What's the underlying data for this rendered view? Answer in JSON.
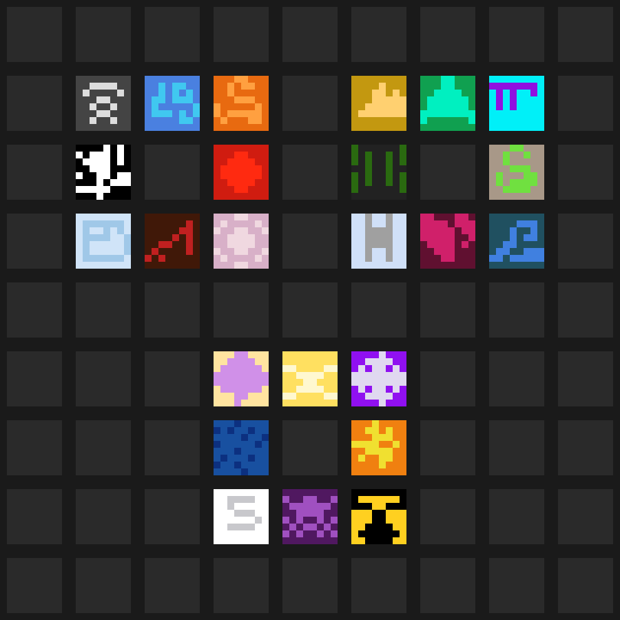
{
  "board": {
    "rows": 9,
    "cols": 9,
    "background": "#1a1a1a",
    "empty_cell_color": "#2a2a2a"
  },
  "tiles": [
    {
      "name": "signal-tile",
      "row": 1,
      "col": 1,
      "bg": "#444444",
      "fg": "#dddddd",
      "pattern": [
        "........",
        "..####..",
        ".#....#.",
        "...##...",
        "..#..#..",
        "...##...",
        "..#..#..",
        "........"
      ]
    },
    {
      "name": "water-tile",
      "row": 1,
      "col": 2,
      "bg": "#4a80e0",
      "fg": "#40c8f0",
      "pattern": [
        "........",
        "..#.##..",
        "..#.#.#.",
        ".##.###.",
        ".#.....#",
        ".###.#.#",
        ".....##.",
        "........"
      ]
    },
    {
      "name": "flame-tile",
      "row": 1,
      "col": 3,
      "bg": "#e86a10",
      "fg": "#ffa040",
      "pattern": [
        "...##...",
        "..#.##..",
        "..#.....",
        "...###..",
        "#.....#.",
        "#.#####.",
        ".#...##.",
        "........"
      ]
    },
    {
      "name": "mountain-tile",
      "row": 1,
      "col": 5,
      "bg": "#c39810",
      "fg": "#ffd070",
      "pattern": [
        "........",
        "....#...",
        "...##.#.",
        "...#####",
        "..######",
        ".#######",
        "........",
        "........"
      ]
    },
    {
      "name": "bell-tile",
      "row": 1,
      "col": 6,
      "bg": "#10a050",
      "fg": "#00f0c0",
      "pattern": [
        "...##...",
        "...##...",
        "..####..",
        ".######.",
        ".######.",
        "########",
        "#......#",
        "........"
      ]
    },
    {
      "name": "rune-tile",
      "row": 1,
      "col": 7,
      "bg": "#00f0f8",
      "fg": "#9010e0",
      "pattern": [
        "........",
        "#######.",
        ".#.#..#.",
        ".#.#....",
        ".#.#....",
        "........",
        "........",
        "........"
      ]
    },
    {
      "name": "star-burst-tile",
      "row": 2,
      "col": 1,
      "bg": "#000000",
      "fg": "#ffffff",
      "pattern": [
        "....#.#.",
        "#.###.#.",
        ".####.#.",
        "..###...",
        "#..##.##",
        "...#.###",
        "#####...",
        "...#...."
      ]
    },
    {
      "name": "fire-orb-tile",
      "row": 2,
      "col": 3,
      "bg": "#d01c10",
      "fg": "#ff2a10",
      "pattern": [
        "........",
        "...##...",
        "..####..",
        ".######.",
        ".######.",
        "..####..",
        "...##...",
        "........"
      ]
    },
    {
      "name": "vine-tile",
      "row": 2,
      "col": 5,
      "bg": "#222222",
      "fg": "#2a6a10",
      "pattern": [
        "#......#",
        "#.#..#.#",
        "#.#..#.#",
        "..#..#..",
        "#.#..#.#",
        "#.#..#.#",
        "#......#",
        "........"
      ]
    },
    {
      "name": "serpent-tile",
      "row": 2,
      "col": 7,
      "bg": "#a89888",
      "fg": "#70e040",
      "pattern": [
        "...##...",
        "..#..#..",
        "..#.....",
        "...###..",
        ".#...##.",
        ".#.####.",
        "..####..",
        "........"
      ]
    },
    {
      "name": "ice-block-tile",
      "row": 3,
      "col": 1,
      "bg": "#d0e4f8",
      "fg": "#a0c8e8",
      "pattern": [
        "........",
        ".######.",
        ".#..#.#.",
        ".####..#",
        ".#.....#",
        ".#.....#",
        ".######.",
        "........"
      ]
    },
    {
      "name": "crack-tile",
      "row": 3,
      "col": 2,
      "bg": "#401808",
      "fg": "#c02020",
      "pattern": [
        "........",
        "......#.",
        ".....##.",
        "....#.#.",
        "..##..#.",
        ".#....#.",
        "#.#.....",
        "........"
      ]
    },
    {
      "name": "pink-rose-tile",
      "row": 3,
      "col": 3,
      "bg": "#d8b0c8",
      "fg": "#f0d8e0",
      "pattern": [
        "...##...",
        ".#....#.",
        "#..##..#",
        "..####..",
        "..####..",
        "#..##..#",
        ".#....#.",
        "...##..."
      ]
    },
    {
      "name": "pillar-tile",
      "row": 3,
      "col": 5,
      "bg": "#d0e0f8",
      "fg": "#a0a0a0",
      "pattern": [
        "..#..#..",
        "..#..#..",
        "..####..",
        "..####..",
        "..####..",
        "..#..#..",
        "..#..#..",
        "........"
      ]
    },
    {
      "name": "broken-heart-tile",
      "row": 3,
      "col": 6,
      "bg": "#601030",
      "fg": "#d0206a",
      "pattern": [
        "##...##.",
        "####.###",
        "#####.##",
        "#####..#",
        ".####.#.",
        "..###...",
        "...##...",
        "........"
      ]
    },
    {
      "name": "wave-tile",
      "row": 3,
      "col": 7,
      "bg": "#205060",
      "fg": "#4080e0",
      "pattern": [
        "........",
        "....###.",
        "...#..#.",
        "...#.##.",
        "..##....",
        ".##..###",
        "##.#####",
        "........"
      ]
    },
    {
      "name": "jelly-tile",
      "row": 5,
      "col": 3,
      "bg": "#ffe4a0",
      "fg": "#d090e8",
      "pattern": [
        "...##...",
        "..####..",
        ".######.",
        "########",
        "########",
        ".######.",
        "...##...",
        "...#...."
      ]
    },
    {
      "name": "bone-tile",
      "row": 5,
      "col": 4,
      "bg": "#ffe060",
      "fg": "#fff8d0",
      "pattern": [
        "........",
        "........",
        "##....##",
        "..####..",
        "...##...",
        "..####..",
        "##....##",
        "........"
      ]
    },
    {
      "name": "crystal-tile",
      "row": 5,
      "col": 5,
      "bg": "#9010f0",
      "fg": "#e0d8f0",
      "pattern": [
        "....#...",
        "..####..",
        ".#.##.#.",
        "########",
        "########",
        ".#.##.#.",
        "..####..",
        "....#..."
      ]
    },
    {
      "name": "deep-sea-tile",
      "row": 6,
      "col": 3,
      "bg": "#1850a0",
      "fg": "#0c3080",
      "pattern": [
        "...#....",
        "#.#..#..",
        "....#..#",
        "#.....#.",
        "...#....",
        ".#...#..",
        "#..#....",
        "....#..."
      ]
    },
    {
      "name": "lava-tile",
      "row": 6,
      "col": 5,
      "bg": "#f08010",
      "fg": "#f0e030",
      "pattern": [
        "...#....",
        "..##.#..",
        "...###..",
        "####..#.",
        "..####..",
        ".#..##..",
        "....#...",
        "........"
      ]
    },
    {
      "name": "swirl-tile",
      "row": 7,
      "col": 3,
      "bg": "#ffffff",
      "fg": "#c8c8cc",
      "pattern": [
        "........",
        "..####..",
        "..#.....",
        "...###..",
        "......#.",
        "..####..",
        "........",
        "........"
      ]
    },
    {
      "name": "shadow-tile",
      "row": 7,
      "col": 4,
      "bg": "#501860",
      "fg": "#a050c0",
      "pattern": [
        "........",
        "#..##..#",
        ".######.",
        "..####..",
        "#.#..#.#",
        ".#.##.#.",
        "#.#..#.#",
        "........"
      ]
    },
    {
      "name": "totem-tile",
      "row": 7,
      "col": 5,
      "bg": "#ffd020",
      "fg": "#000000",
      "pattern": [
        "########",
        "#......#",
        "###..###",
        "...##...",
        "...##...",
        "..####..",
        ".######.",
        "..####.."
      ]
    }
  ]
}
